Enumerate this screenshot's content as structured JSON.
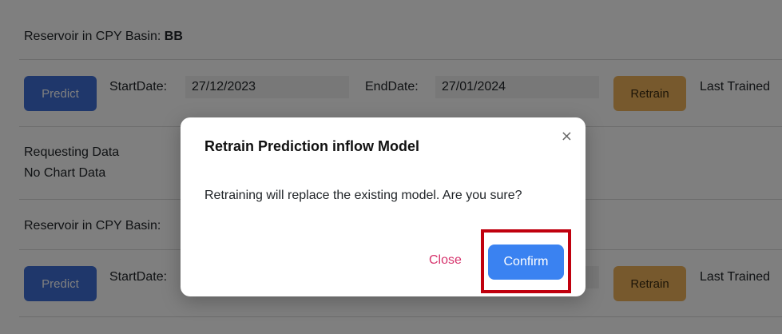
{
  "rows": [
    {
      "title_prefix": "Reservoir in CPY Basin: ",
      "title_bold": "BB"
    },
    {
      "title_prefix": "Reservoir in CPY Basin: ",
      "title_bold": ""
    }
  ],
  "controls": {
    "predict_label": "Predict",
    "start_label": "StartDate:",
    "start_value": "27/12/2023",
    "end_label": "EndDate:",
    "end_value": "27/01/2024",
    "retrain_label": "Retrain",
    "last_trained_label": "Last Trained"
  },
  "status": {
    "requesting": "Requesting Data",
    "no_chart": "No Chart Data"
  },
  "modal": {
    "title": "Retrain Prediction inflow Model",
    "close_icon": "×",
    "body": "Retraining will replace the existing model. Are you sure?",
    "close_label": "Close",
    "confirm_label": "Confirm"
  },
  "colors": {
    "predict": "#3f6fd6",
    "retrain": "#efb35a",
    "confirm": "#3a82f1",
    "close_link": "#d6336c",
    "highlight": "#c0000e"
  }
}
